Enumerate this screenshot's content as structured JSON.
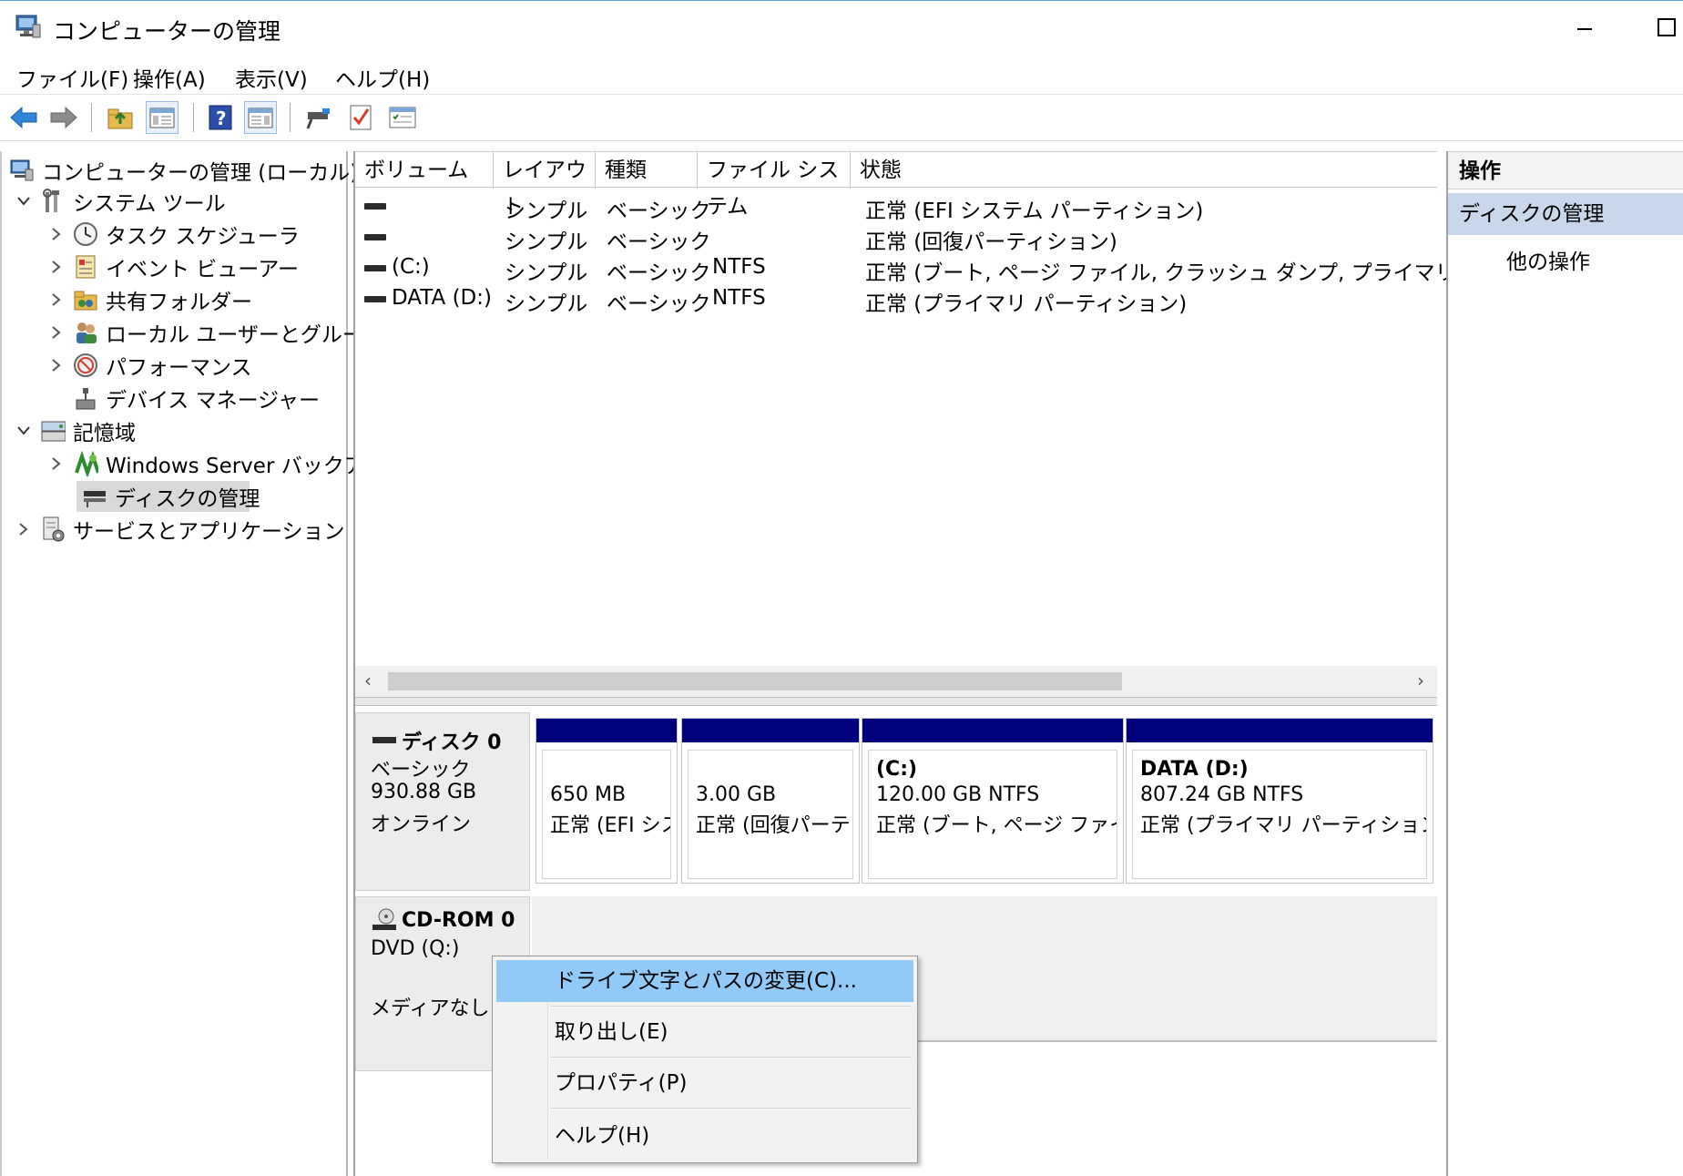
{
  "window": {
    "title": "コンピューターの管理",
    "minimize_glyph": "—",
    "maximize_glyph": "☐"
  },
  "menu": [
    "ファイル(F)",
    "操作(A)",
    "表示(V)",
    "ヘルプ(H)"
  ],
  "tree": {
    "root": "コンピューターの管理 (ローカル)",
    "system_tools": "システム ツール",
    "task_scheduler": "タスク スケジューラ",
    "event_viewer": "イベント ビューアー",
    "shared_folders": "共有フォルダー",
    "local_users": "ローカル ユーザーとグループ",
    "performance": "パフォーマンス",
    "device_manager": "デバイス マネージャー",
    "storage": "記憶域",
    "windows_backup": "Windows Server バックアップ",
    "disk_management": "ディスクの管理",
    "services_apps": "サービスとアプリケーション"
  },
  "volume_list": {
    "headers": [
      "ボリューム",
      "レイアウト",
      "種類",
      "ファイル システム",
      "状態"
    ],
    "rows": [
      {
        "volume": "",
        "layout": "シンプル",
        "type": "ベーシック",
        "fs": "",
        "status": "正常 (EFI システム パーティション)"
      },
      {
        "volume": "",
        "layout": "シンプル",
        "type": "ベーシック",
        "fs": "",
        "status": "正常 (回復パーティション)"
      },
      {
        "volume": "(C:)",
        "layout": "シンプル",
        "type": "ベーシック",
        "fs": "NTFS",
        "status": "正常 (ブート, ページ ファイル, クラッシュ ダンプ, プライマリ パーティション)"
      },
      {
        "volume": "DATA (D:)",
        "layout": "シンプル",
        "type": "ベーシック",
        "fs": "NTFS",
        "status": "正常 (プライマリ パーティション)"
      }
    ],
    "scroll_left": "‹",
    "scroll_right": "›"
  },
  "disk0": {
    "name": "ディスク 0",
    "type": "ベーシック",
    "size": "930.88 GB",
    "state": "オンライン",
    "partitions": [
      {
        "title": "",
        "size": "650 MB",
        "status": "正常 (EFI シス"
      },
      {
        "title": "",
        "size": "3.00 GB",
        "status": "正常 (回復パーテ"
      },
      {
        "title": "(C:)",
        "size": "120.00 GB NTFS",
        "status": "正常 (ブート, ページ ファイル,"
      },
      {
        "title": "DATA  (D:)",
        "size": "807.24 GB NTFS",
        "status": "正常 (プライマリ パーティション)"
      }
    ]
  },
  "cdrom0": {
    "name": "CD-ROM 0",
    "drive": "DVD (Q:)",
    "media": "メディアなし"
  },
  "context_menu": [
    "ドライブ文字とパスの変更(C)...",
    "取り出し(E)",
    "プロパティ(P)",
    "ヘルプ(H)"
  ],
  "actions": {
    "header": "操作",
    "selected": "ディスクの管理",
    "more": "他の操作"
  }
}
